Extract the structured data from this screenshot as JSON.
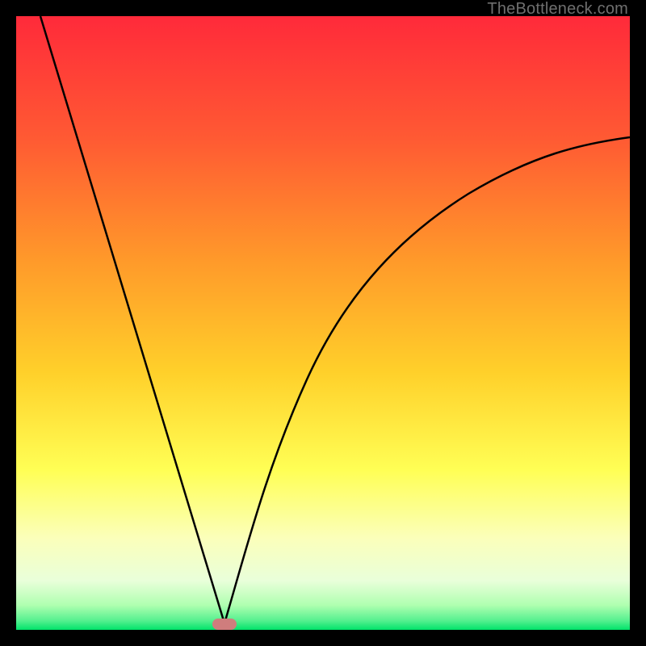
{
  "watermark": "TheBottleneck.com",
  "colors": {
    "bg_black": "#000000",
    "grad_top": "#ff2a3a",
    "grad_mid1": "#ff7a2a",
    "grad_mid2": "#ffd02a",
    "grad_mid3": "#ffff66",
    "grad_mid4": "#fdffce",
    "grad_low1": "#c6ffb2",
    "grad_bottom": "#00e36a",
    "curve": "#000000",
    "marker": "#cf7d7d"
  },
  "chart_data": {
    "type": "line",
    "title": "",
    "xlabel": "",
    "ylabel": "",
    "xlim": [
      0,
      100
    ],
    "ylim": [
      0,
      100
    ],
    "x_min_point": 34,
    "y_at_min": 0,
    "left_branch": [
      {
        "x": 4,
        "y": 100
      },
      {
        "x": 10,
        "y": 80
      },
      {
        "x": 16,
        "y": 60
      },
      {
        "x": 22,
        "y": 40
      },
      {
        "x": 28,
        "y": 20
      },
      {
        "x": 34,
        "y": 0
      }
    ],
    "right_branch": [
      {
        "x": 34,
        "y": 0
      },
      {
        "x": 38,
        "y": 15
      },
      {
        "x": 44,
        "y": 34
      },
      {
        "x": 52,
        "y": 50
      },
      {
        "x": 62,
        "y": 62
      },
      {
        "x": 74,
        "y": 70
      },
      {
        "x": 88,
        "y": 76
      },
      {
        "x": 100,
        "y": 80
      }
    ],
    "marker": {
      "x": 34,
      "y": 0
    },
    "annotations": [
      "TheBottleneck.com"
    ]
  }
}
